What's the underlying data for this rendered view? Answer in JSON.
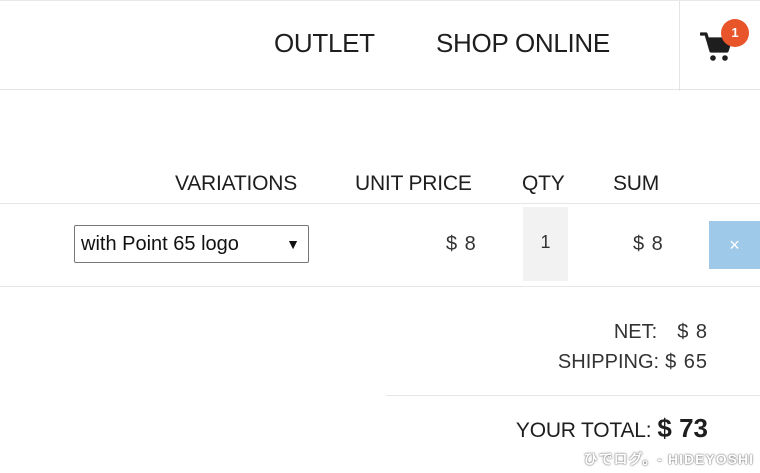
{
  "nav": {
    "outlet": "OUTLET",
    "shop_online": "SHOP ONLINE"
  },
  "cart": {
    "count": "1",
    "icon": "shopping-cart-icon"
  },
  "table": {
    "headers": {
      "variations": "VARIATIONS",
      "unit_price": "UNIT PRICE",
      "qty": "QTY",
      "sum": "SUM"
    },
    "rows": [
      {
        "variation": "with Point 65 logo",
        "unit_price": "$ 8",
        "qty": "1",
        "sum": "$ 8",
        "remove_label": "×"
      }
    ]
  },
  "summary": {
    "net_label": "NET:",
    "net_value": "$ 8",
    "shipping_label": "SHIPPING:",
    "shipping_value": "$ 65",
    "total_label": "YOUR TOTAL:",
    "total_value": "$ 73"
  },
  "watermark": "ひでログ。- HIDEYOSHI",
  "colors": {
    "badge": "#e8552a",
    "remove_button": "#9ec9e8",
    "qty_background": "#f2f2f2"
  }
}
